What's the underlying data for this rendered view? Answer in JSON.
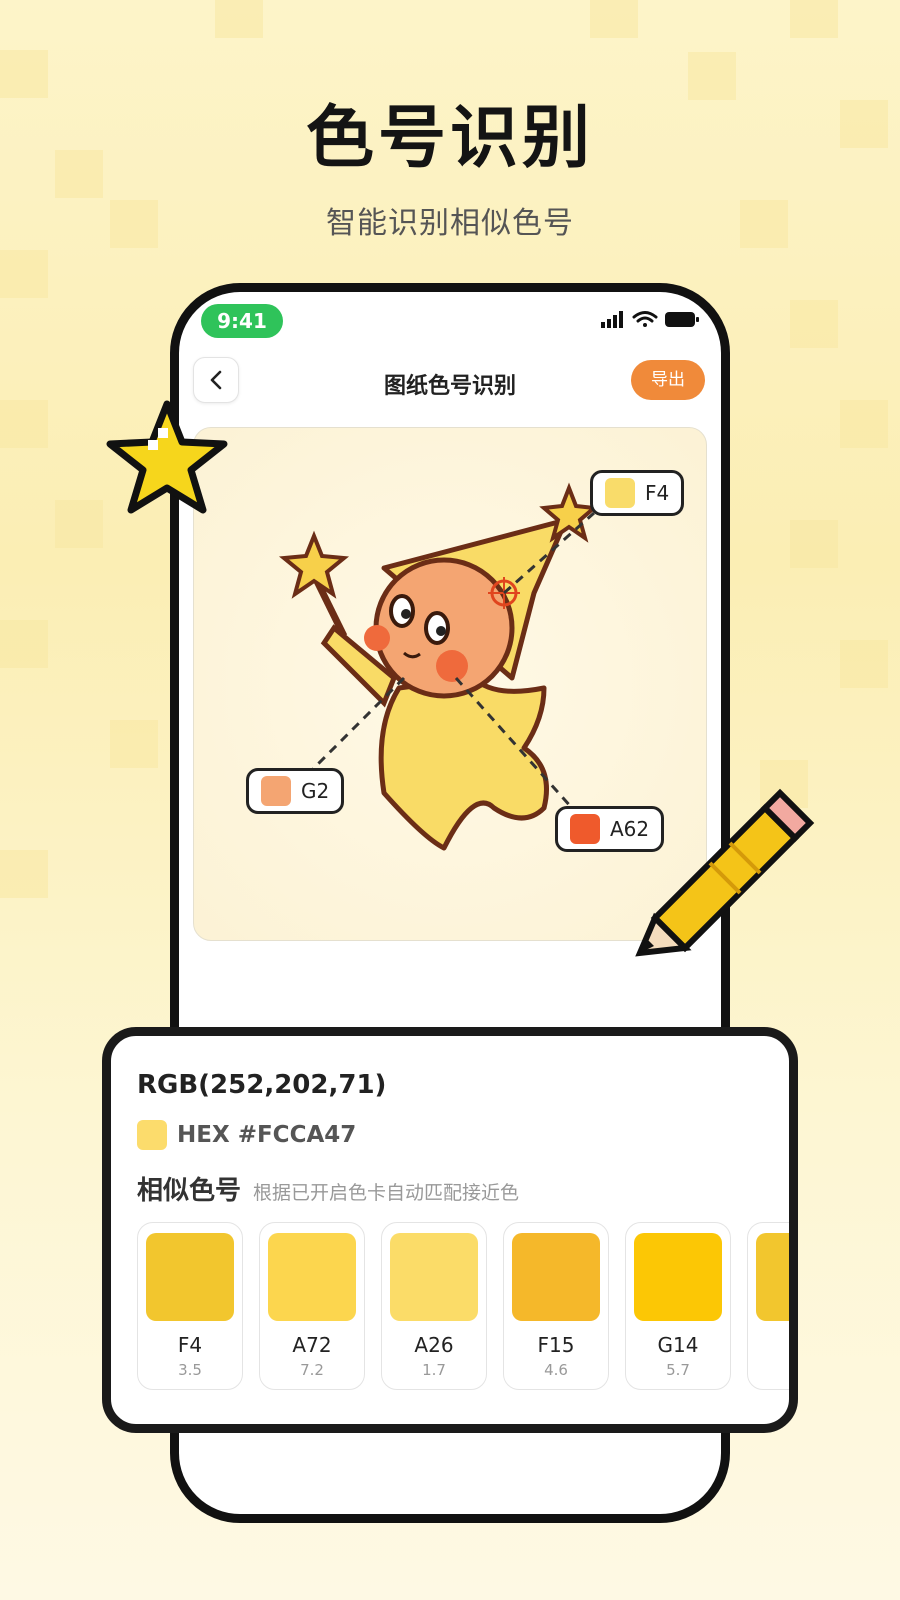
{
  "hero": {
    "title": "色号识别",
    "subtitle": "智能识别相似色号"
  },
  "status_bar": {
    "time": "9:41"
  },
  "nav": {
    "title": "图纸色号识别",
    "export_label": "导出"
  },
  "color_tags": [
    {
      "code": "F4",
      "color": "#f9dc6a"
    },
    {
      "code": "G2",
      "color": "#f4a572"
    },
    {
      "code": "A62",
      "color": "#ef5a2c"
    }
  ],
  "picked": {
    "rgb": "RGB(252,202,71)",
    "hex": "HEX #FCCA47",
    "color": "#fcdc6c"
  },
  "similar": {
    "title": "相似色号",
    "note": "根据已开启色卡自动匹配接近色",
    "items": [
      {
        "code": "F4",
        "distance": "3.5",
        "color": "#f2c62e"
      },
      {
        "code": "A72",
        "distance": "7.2",
        "color": "#fcd64e"
      },
      {
        "code": "A26",
        "distance": "1.7",
        "color": "#fbdc68"
      },
      {
        "code": "F15",
        "distance": "4.6",
        "color": "#f5b82a"
      },
      {
        "code": "G14",
        "distance": "5.7",
        "color": "#fcc705"
      },
      {
        "code": "",
        "distance": "",
        "color": "#f2c62e"
      }
    ]
  }
}
